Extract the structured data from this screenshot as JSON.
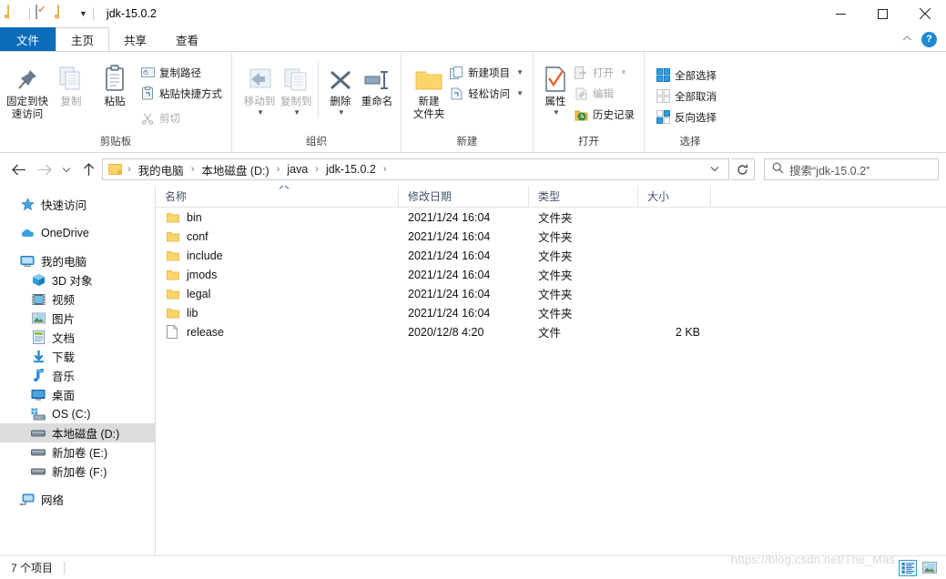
{
  "window": {
    "title": "jdk-15.0.2",
    "quick_access": [
      {
        "name": "folder-icon",
        "label": ""
      },
      {
        "name": "properties-icon",
        "label": ""
      },
      {
        "name": "new-folder-icon",
        "label": ""
      },
      {
        "name": "customize-caret-icon",
        "label": ""
      }
    ],
    "controls": {
      "minimize": "─",
      "maximize": "□",
      "close": "✕"
    }
  },
  "tabs": [
    {
      "id": "file",
      "label": "文件"
    },
    {
      "id": "home",
      "label": "主页"
    },
    {
      "id": "share",
      "label": "共享"
    },
    {
      "id": "view",
      "label": "查看"
    }
  ],
  "tabs_right": {
    "collapse": "＾",
    "help": "?"
  },
  "ribbon": {
    "groups": [
      {
        "id": "clipboard",
        "label": "剪贴板",
        "big_buttons": [
          {
            "id": "pin-to-quick-access",
            "label_line1": "固定到快",
            "label_line2": "速访问",
            "dim": false
          },
          {
            "id": "copy",
            "label_line1": "复制",
            "label_line2": "",
            "dim": true
          },
          {
            "id": "paste",
            "label_line1": "粘贴",
            "label_line2": "",
            "dim": false
          }
        ],
        "small_buttons": [
          {
            "id": "copy-path",
            "label": "复制路径",
            "dim": false
          },
          {
            "id": "paste-shortcut",
            "label": "粘贴快捷方式",
            "dim": false
          },
          {
            "id": "cut",
            "label": "剪切",
            "dim": true
          }
        ]
      },
      {
        "id": "organize",
        "label": "组织",
        "big_buttons": [
          {
            "id": "move-to",
            "label_line1": "移动到",
            "label_line2": "",
            "dim": true
          },
          {
            "id": "copy-to",
            "label_line1": "复制到",
            "label_line2": "",
            "dim": true
          },
          {
            "id": "delete",
            "label_line1": "删除",
            "label_line2": "",
            "dim": false
          },
          {
            "id": "rename",
            "label_line1": "重命名",
            "label_line2": "",
            "dim": false
          }
        ],
        "small_buttons": []
      },
      {
        "id": "new",
        "label": "新建",
        "big_buttons": [
          {
            "id": "new-folder",
            "label_line1": "新建",
            "label_line2": "文件夹",
            "dim": false
          }
        ],
        "small_buttons": [
          {
            "id": "new-item",
            "label": "新建项目",
            "dim": false,
            "has_caret": true
          },
          {
            "id": "easy-access",
            "label": "轻松访问",
            "dim": false,
            "has_caret": true
          }
        ]
      },
      {
        "id": "open",
        "label": "打开",
        "big_buttons": [
          {
            "id": "properties",
            "label_line1": "属性",
            "label_line2": "",
            "dim": false
          }
        ],
        "small_buttons": [
          {
            "id": "open",
            "label": "打开",
            "dim": true,
            "has_caret": true
          },
          {
            "id": "edit",
            "label": "编辑",
            "dim": true
          },
          {
            "id": "history",
            "label": "历史记录",
            "dim": false
          }
        ]
      },
      {
        "id": "select",
        "label": "选择",
        "big_buttons": [],
        "small_buttons": [
          {
            "id": "select-all",
            "label": "全部选择",
            "dim": false
          },
          {
            "id": "select-none",
            "label": "全部取消",
            "dim": false
          },
          {
            "id": "invert-selection",
            "label": "反向选择",
            "dim": false
          }
        ]
      }
    ]
  },
  "address": {
    "back": "←",
    "forward": "→",
    "recent_caret": "˅",
    "up": "↑",
    "crumbs": [
      "我的电脑",
      "本地磁盘 (D:)",
      "java",
      "jdk-15.0.2"
    ],
    "separator": "›",
    "dropdown_caret": "˅",
    "refresh": "↻"
  },
  "search": {
    "placeholder": "搜索“jdk-15.0.2”"
  },
  "sidebar": {
    "items": [
      {
        "id": "quick-access",
        "label": "快速访问",
        "icon": "star-pin-icon",
        "indent": false,
        "selected": false
      },
      {
        "id": "onedrive",
        "label": "OneDrive",
        "icon": "cloud-icon",
        "indent": false,
        "selected": false
      },
      {
        "id": "this-pc",
        "label": "我的电脑",
        "icon": "monitor-icon",
        "indent": false,
        "selected": false
      },
      {
        "id": "3d-objects",
        "label": "3D 对象",
        "icon": "cube-icon",
        "indent": true,
        "selected": false
      },
      {
        "id": "videos",
        "label": "视频",
        "icon": "film-icon",
        "indent": true,
        "selected": false
      },
      {
        "id": "pictures",
        "label": "图片",
        "icon": "picture-icon",
        "indent": true,
        "selected": false
      },
      {
        "id": "documents",
        "label": "文档",
        "icon": "document-icon",
        "indent": true,
        "selected": false
      },
      {
        "id": "downloads",
        "label": "下载",
        "icon": "download-arrow-icon",
        "indent": true,
        "selected": false
      },
      {
        "id": "music",
        "label": "音乐",
        "icon": "music-note-icon",
        "indent": true,
        "selected": false
      },
      {
        "id": "desktop",
        "label": "桌面",
        "icon": "desktop-icon",
        "indent": true,
        "selected": false
      },
      {
        "id": "os-c",
        "label": "OS (C:)",
        "icon": "system-drive-icon",
        "indent": true,
        "selected": false
      },
      {
        "id": "local-disk-d",
        "label": "本地磁盘 (D:)",
        "icon": "drive-icon",
        "indent": true,
        "selected": true
      },
      {
        "id": "new-volume-e",
        "label": "新加卷 (E:)",
        "icon": "drive-icon",
        "indent": true,
        "selected": false
      },
      {
        "id": "new-volume-f",
        "label": "新加卷 (F:)",
        "icon": "drive-icon",
        "indent": true,
        "selected": false
      },
      {
        "id": "network",
        "label": "网络",
        "icon": "network-icon",
        "indent": false,
        "selected": false
      }
    ]
  },
  "filelist": {
    "columns": [
      {
        "id": "name",
        "label": "名称",
        "sorted": true,
        "sort_dir": "asc"
      },
      {
        "id": "date",
        "label": "修改日期"
      },
      {
        "id": "type",
        "label": "类型"
      },
      {
        "id": "size",
        "label": "大小"
      }
    ],
    "rows": [
      {
        "name": "bin",
        "date": "2021/1/24 16:04",
        "type": "文件夹",
        "size": "",
        "icon": "folder-icon"
      },
      {
        "name": "conf",
        "date": "2021/1/24 16:04",
        "type": "文件夹",
        "size": "",
        "icon": "folder-icon"
      },
      {
        "name": "include",
        "date": "2021/1/24 16:04",
        "type": "文件夹",
        "size": "",
        "icon": "folder-icon"
      },
      {
        "name": "jmods",
        "date": "2021/1/24 16:04",
        "type": "文件夹",
        "size": "",
        "icon": "folder-icon"
      },
      {
        "name": "legal",
        "date": "2021/1/24 16:04",
        "type": "文件夹",
        "size": "",
        "icon": "folder-icon"
      },
      {
        "name": "lib",
        "date": "2021/1/24 16:04",
        "type": "文件夹",
        "size": "",
        "icon": "folder-icon"
      },
      {
        "name": "release",
        "date": "2020/12/8 4:20",
        "type": "文件",
        "size": "2 KB",
        "icon": "file-icon"
      }
    ]
  },
  "statusbar": {
    "item_count": "7 个项目",
    "watermark": "https://blog.csdn.net/The_Mas",
    "views": [
      {
        "id": "details-view",
        "selected": true
      },
      {
        "id": "large-icons-view",
        "selected": false
      }
    ]
  },
  "colors": {
    "accent": "#0d6cba",
    "folder": "#fcd56a",
    "header_text": "#44546a",
    "selection": "#dcdcdc"
  }
}
